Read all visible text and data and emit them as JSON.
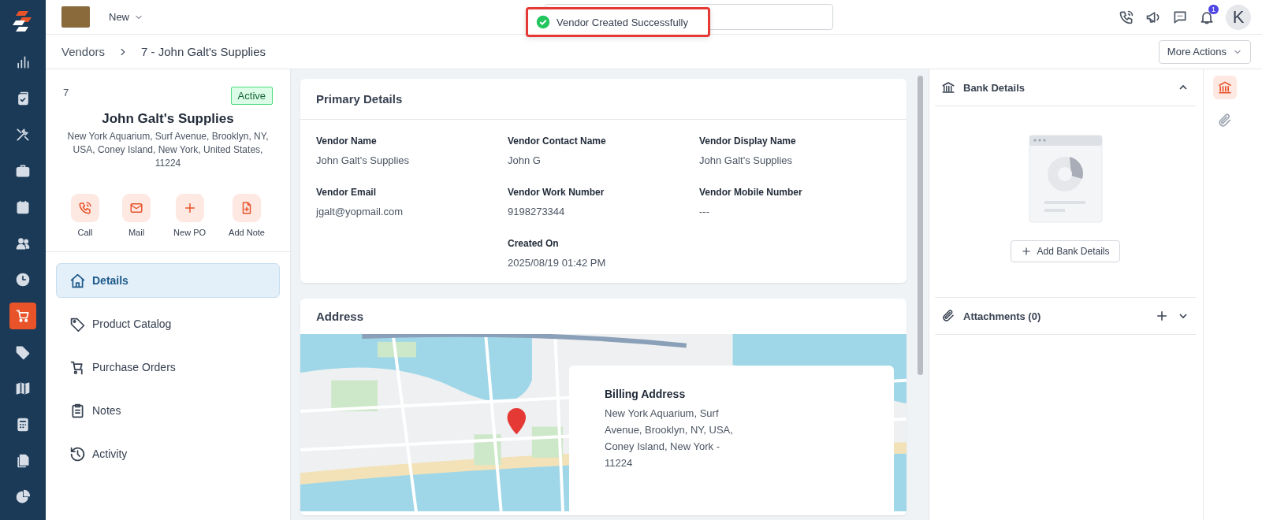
{
  "nav_items": [
    {
      "selected": false
    },
    {
      "selected": false
    },
    {
      "selected": false
    },
    {
      "selected": false
    },
    {
      "selected": false
    },
    {
      "selected": false
    },
    {
      "selected": false
    },
    {
      "selected": true
    },
    {
      "selected": false
    },
    {
      "selected": false
    },
    {
      "selected": false
    },
    {
      "selected": false
    },
    {
      "selected": false
    }
  ],
  "top_bar": {
    "menu_label": "New",
    "notification_count": "1",
    "avatar_initial": "K"
  },
  "toast": {
    "message": "Vendor Created Successfully"
  },
  "breadcrumb": {
    "parent": "Vendors",
    "current": "7 - John Galt's Supplies"
  },
  "more_actions": "More Actions",
  "vendor": {
    "id": "7",
    "status": "Active",
    "name": "John Galt's Supplies",
    "address": "New York Aquarium, Surf Avenue, Brooklyn, NY, USA, Coney Island, New York, United States, 11224"
  },
  "actions": [
    {
      "label": "Call"
    },
    {
      "label": "Mail"
    },
    {
      "label": "New PO"
    },
    {
      "label": "Add Note"
    }
  ],
  "menu": [
    {
      "label": "Details",
      "selected": true
    },
    {
      "label": "Product Catalog",
      "selected": false
    },
    {
      "label": "Purchase Orders",
      "selected": false
    },
    {
      "label": "Notes",
      "selected": false
    },
    {
      "label": "Activity",
      "selected": false
    }
  ],
  "primary_details": {
    "title": "Primary Details",
    "columns": [
      [
        {
          "label": "Vendor Name",
          "value": "John Galt's Supplies"
        },
        {
          "label": "Vendor Email",
          "value": "jgalt@yopmail.com"
        }
      ],
      [
        {
          "label": "Vendor Contact Name",
          "value": "John G"
        },
        {
          "label": "Vendor Work Number",
          "value": "9198273344"
        },
        {
          "label": "Created On",
          "value": "2025/08/19 01:42 PM"
        }
      ],
      [
        {
          "label": "Vendor Display Name",
          "value": "John Galt's Supplies"
        },
        {
          "label": "Vendor Mobile Number",
          "value": "---"
        }
      ]
    ]
  },
  "address": {
    "title": "Address",
    "billing": {
      "title": "Billing Address",
      "lines": [
        "New York Aquarium, Surf Avenue, Brooklyn, NY, USA,",
        "Coney Island, New York - 11224"
      ]
    }
  },
  "bank_details": {
    "title": "Bank Details",
    "expanded": true,
    "button": "Add Bank Details"
  },
  "attachments": {
    "title": "Attachments (0)",
    "expanded": false
  },
  "side_tabs": [
    {
      "selected": true
    },
    {
      "selected": false
    }
  ]
}
